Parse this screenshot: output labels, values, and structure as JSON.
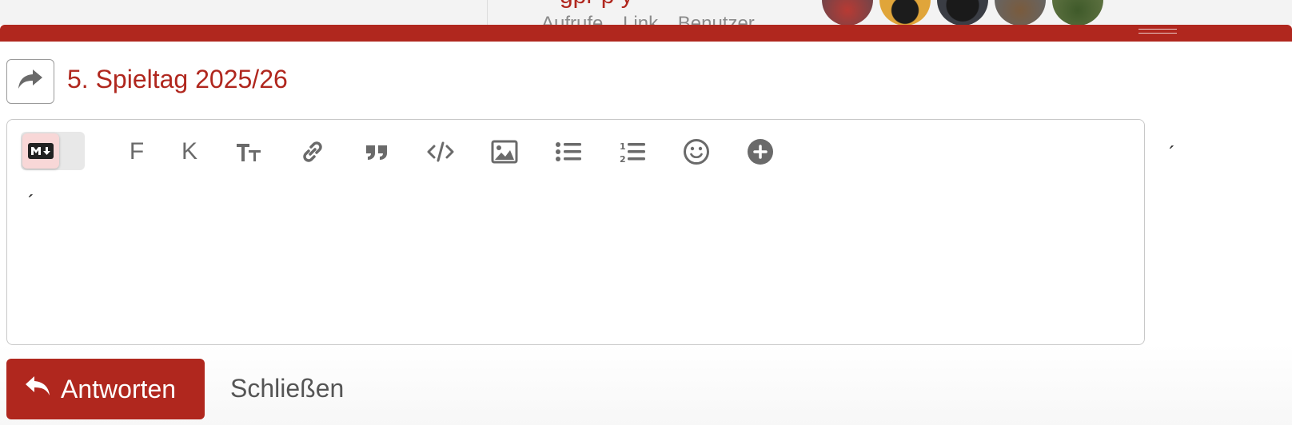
{
  "background": {
    "topic_stats": "Aufrufe Link Benutzer",
    "avatars": [
      {
        "name": "avatar-1",
        "color": "#8a3b3b"
      },
      {
        "name": "avatar-2",
        "color": "#d9a23a"
      },
      {
        "name": "avatar-3",
        "color": "#2d2f33"
      },
      {
        "name": "avatar-4",
        "color": "#6b5a42"
      },
      {
        "name": "avatar-5",
        "color": "#556b3a"
      }
    ]
  },
  "composer": {
    "topic_title": "5. Spieltag 2025/26",
    "editor_content": "´",
    "side_content": "´",
    "toolbar": [
      {
        "name": "bold-button",
        "label": "F"
      },
      {
        "name": "italic-button",
        "label": "K"
      },
      {
        "name": "heading-button",
        "icon": "text-size-icon"
      },
      {
        "name": "link-button",
        "icon": "link-icon"
      },
      {
        "name": "quote-button",
        "icon": "quote-icon"
      },
      {
        "name": "code-button",
        "icon": "code-icon"
      },
      {
        "name": "image-button",
        "icon": "image-icon"
      },
      {
        "name": "bullet-list-button",
        "icon": "bullet-list-icon"
      },
      {
        "name": "numbered-list-button",
        "icon": "numbered-list-icon"
      },
      {
        "name": "emoji-button",
        "icon": "smile-icon"
      },
      {
        "name": "more-button",
        "icon": "plus-circle-icon"
      }
    ],
    "submit_label": "Antworten",
    "close_label": "Schließen"
  },
  "colors": {
    "accent": "#b0271e",
    "icon": "#6a6a6a"
  }
}
